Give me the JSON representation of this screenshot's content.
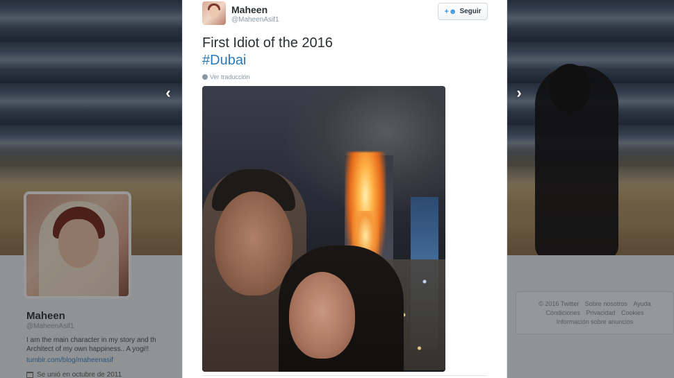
{
  "background_profile": {
    "name": "Maheen",
    "handle": "@MaheenAsif1",
    "bio": "I am the main character in my story and th Architect of my own happiness.. A yogi!!",
    "link": "tumblr.com/blog/maheenasif",
    "joined": "Se unió en octubre de 2011"
  },
  "footer": {
    "line1": [
      "© 2016 Twitter",
      "Sobre nosotros",
      "Ayuda"
    ],
    "line2": [
      "Condiciones",
      "Privacidad",
      "Cookies"
    ],
    "line3": [
      "Información sobre anuncios"
    ]
  },
  "tweet": {
    "author_name": "Maheen",
    "author_handle": "@MaheenAsif1",
    "follow_label": "Seguir",
    "text": "First Idiot of the 2016",
    "hashtag": "#Dubai",
    "translate_label": "Ver traducción"
  },
  "icons": {
    "prev": "chevron-left-icon",
    "next": "chevron-right-icon",
    "follow": "add-user-icon",
    "translate": "globe-icon",
    "calendar": "calendar-icon"
  },
  "colors": {
    "link_blue": "#2b7bb9",
    "follow_icon": "#3b94d9"
  }
}
